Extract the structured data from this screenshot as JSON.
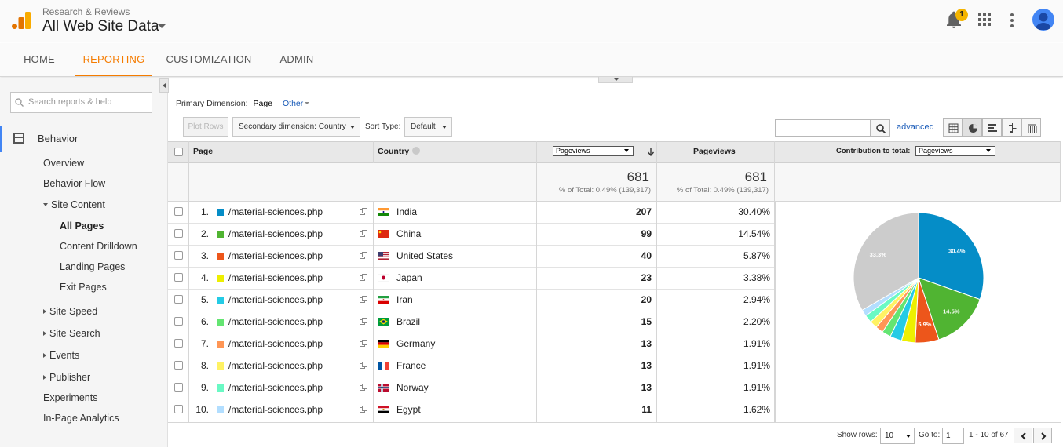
{
  "header": {
    "account_sub": "Research & Reviews",
    "account_main": "All Web Site Data",
    "notifications": "1"
  },
  "nav": {
    "items": [
      "HOME",
      "REPORTING",
      "CUSTOMIZATION",
      "ADMIN"
    ],
    "active": "REPORTING"
  },
  "sidebar": {
    "search_placeholder": "Search reports & help",
    "section": "Behavior",
    "items": [
      {
        "label": "Overview"
      },
      {
        "label": "Behavior Flow"
      },
      {
        "label": "Site Content"
      },
      {
        "label": "All Pages"
      },
      {
        "label": "Content Drilldown"
      },
      {
        "label": "Landing Pages"
      },
      {
        "label": "Exit Pages"
      },
      {
        "label": "Site Speed"
      },
      {
        "label": "Site Search"
      },
      {
        "label": "Events"
      },
      {
        "label": "Publisher"
      },
      {
        "label": "Experiments"
      },
      {
        "label": "In-Page Analytics"
      }
    ]
  },
  "toolbar": {
    "primary_label": "Primary Dimension:",
    "primary_value": "Page",
    "other": "Other",
    "plot_rows": "Plot Rows",
    "secondary": "Secondary dimension: Country",
    "sort_label": "Sort Type:",
    "sort_value": "Default",
    "advanced": "advanced"
  },
  "table": {
    "headers": {
      "page": "Page",
      "country": "Country",
      "metric_select": "Pageviews",
      "metric": "Pageviews",
      "contribution": "Contribution to total:",
      "contribution_select": "Pageviews"
    },
    "totals": {
      "value1": "681",
      "sub1": "% of Total: 0.49% (139,317)",
      "value2": "681",
      "sub2": "% of Total: 0.49% (139,317)"
    },
    "rows": [
      {
        "idx": "1.",
        "page": "/material-sciences.php",
        "country": "India",
        "pageviews": "207",
        "pct": "30.40%",
        "color": "#058dc7",
        "flag": "india"
      },
      {
        "idx": "2.",
        "page": "/material-sciences.php",
        "country": "China",
        "pageviews": "99",
        "pct": "14.54%",
        "color": "#50b432",
        "flag": "china"
      },
      {
        "idx": "3.",
        "page": "/material-sciences.php",
        "country": "United States",
        "pageviews": "40",
        "pct": "5.87%",
        "color": "#ed561b",
        "flag": "us"
      },
      {
        "idx": "4.",
        "page": "/material-sciences.php",
        "country": "Japan",
        "pageviews": "23",
        "pct": "3.38%",
        "color": "#edef00",
        "flag": "japan"
      },
      {
        "idx": "5.",
        "page": "/material-sciences.php",
        "country": "Iran",
        "pageviews": "20",
        "pct": "2.94%",
        "color": "#24cbe5",
        "flag": "iran"
      },
      {
        "idx": "6.",
        "page": "/material-sciences.php",
        "country": "Brazil",
        "pageviews": "15",
        "pct": "2.20%",
        "color": "#64e572",
        "flag": "brazil"
      },
      {
        "idx": "7.",
        "page": "/material-sciences.php",
        "country": "Germany",
        "pageviews": "13",
        "pct": "1.91%",
        "color": "#ff9655",
        "flag": "germany"
      },
      {
        "idx": "8.",
        "page": "/material-sciences.php",
        "country": "France",
        "pageviews": "13",
        "pct": "1.91%",
        "color": "#fff263",
        "flag": "france"
      },
      {
        "idx": "9.",
        "page": "/material-sciences.php",
        "country": "Norway",
        "pageviews": "13",
        "pct": "1.91%",
        "color": "#6af9c4",
        "flag": "norway"
      },
      {
        "idx": "10.",
        "page": "/material-sciences.php",
        "country": "Egypt",
        "pageviews": "11",
        "pct": "1.62%",
        "color": "#b2deff",
        "flag": "egypt"
      }
    ]
  },
  "chart_data": {
    "type": "pie",
    "slices": [
      {
        "label": "India",
        "value": 30.4,
        "color": "#058dc7",
        "text": "30.4%"
      },
      {
        "label": "China",
        "value": 14.54,
        "color": "#50b432",
        "text": "14.5%"
      },
      {
        "label": "United States",
        "value": 5.87,
        "color": "#ed561b",
        "text": "5.9%"
      },
      {
        "label": "Japan",
        "value": 3.38,
        "color": "#edef00",
        "text": ""
      },
      {
        "label": "Iran",
        "value": 2.94,
        "color": "#24cbe5",
        "text": ""
      },
      {
        "label": "Brazil",
        "value": 2.2,
        "color": "#64e572",
        "text": ""
      },
      {
        "label": "Germany",
        "value": 1.91,
        "color": "#ff9655",
        "text": ""
      },
      {
        "label": "France",
        "value": 1.91,
        "color": "#fff263",
        "text": ""
      },
      {
        "label": "Norway",
        "value": 1.91,
        "color": "#6af9c4",
        "text": ""
      },
      {
        "label": "Egypt",
        "value": 1.62,
        "color": "#b2deff",
        "text": ""
      },
      {
        "label": "(other)",
        "value": 33.3,
        "color": "#cccccc",
        "text": "33.3%"
      }
    ]
  },
  "footer": {
    "show_rows_label": "Show rows:",
    "show_rows_value": "10",
    "goto_label": "Go to:",
    "goto_value": "1",
    "range": "1 - 10 of 67"
  }
}
